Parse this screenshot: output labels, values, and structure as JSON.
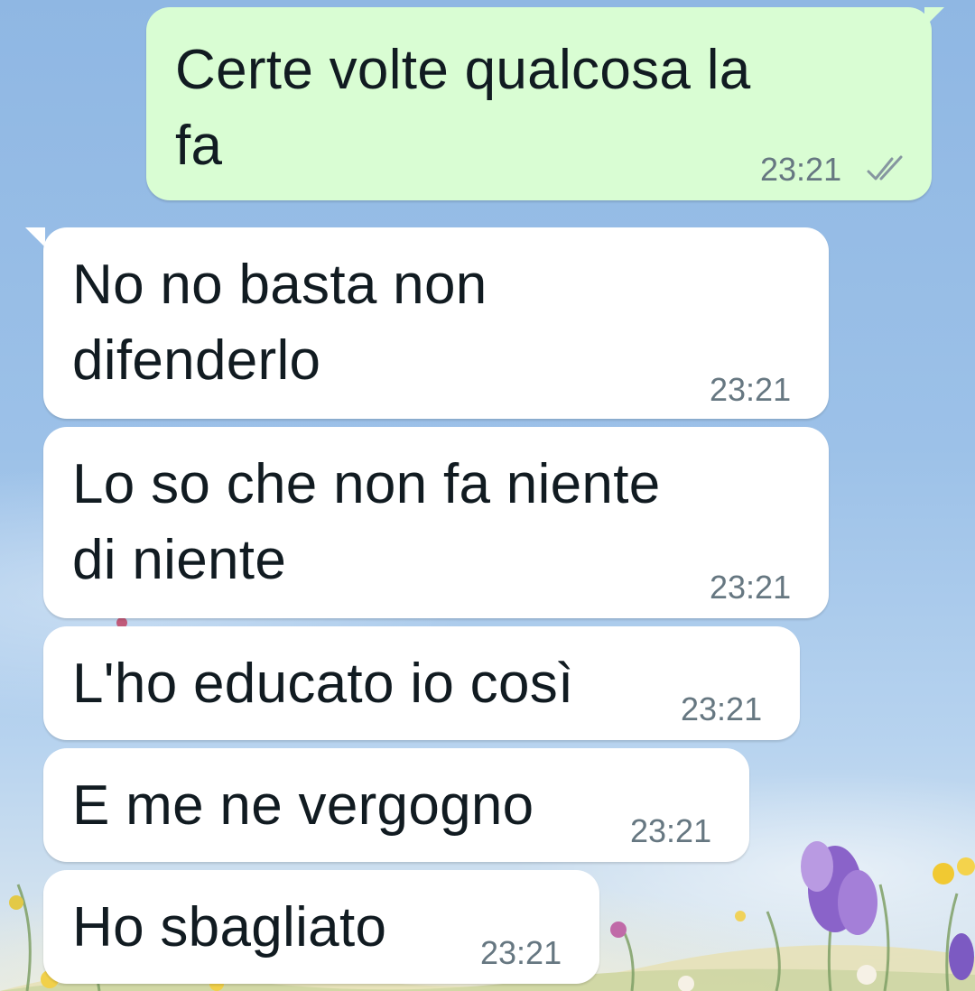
{
  "conversation": {
    "messages": [
      {
        "direction": "outgoing",
        "lines": [
          "Certe volte qualcosa la",
          "fa"
        ],
        "time": "23:21",
        "status_icon": "double-check-icon"
      },
      {
        "direction": "incoming",
        "lines": [
          "No no basta non",
          "difenderlo"
        ],
        "time": "23:21"
      },
      {
        "direction": "incoming",
        "lines": [
          "Lo so che non fa niente",
          "di niente"
        ],
        "time": "23:21"
      },
      {
        "direction": "incoming",
        "lines": [
          "L'ho educato io così"
        ],
        "time": "23:21"
      },
      {
        "direction": "incoming",
        "lines": [
          "E me ne vergogno"
        ],
        "time": "23:21"
      },
      {
        "direction": "incoming",
        "lines": [
          "Ho sbagliato"
        ],
        "time": "23:21"
      }
    ]
  },
  "colors": {
    "outgoing_bubble": "#d9fdd3",
    "incoming_bubble": "#ffffff",
    "text": "#111b21",
    "meta_text": "#667781",
    "sky": "#9cc1e8"
  }
}
